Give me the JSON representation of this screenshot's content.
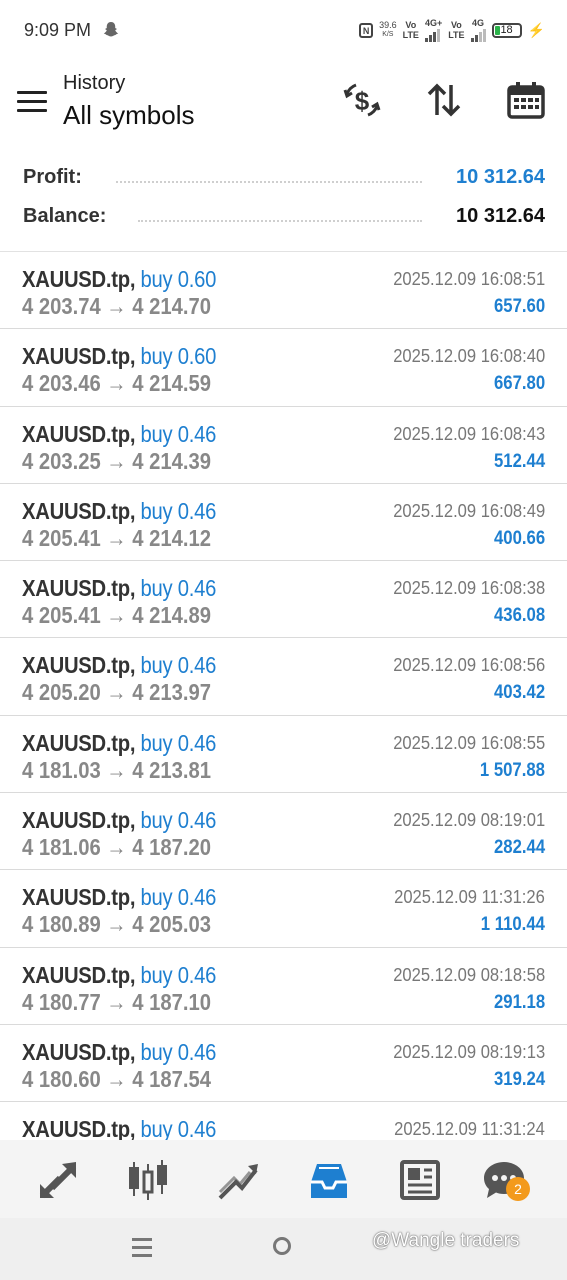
{
  "statusbar": {
    "time": "9:09 PM",
    "nfc": "N",
    "speed_value": "39.6",
    "speed_unit": "K/S",
    "sim1_top": "Vo",
    "sim1_bottom": "LTE",
    "sim1_net": "4G+",
    "sim2_top": "Vo",
    "sim2_bottom": "LTE",
    "sim2_net": "4G",
    "battery": "18"
  },
  "header": {
    "title": "History",
    "subtitle": "All symbols",
    "icons": [
      "dollar-exchange-icon",
      "sort-icon",
      "calendar-icon"
    ]
  },
  "summary": {
    "profit_label": "Profit:",
    "profit_value": "10 312.64",
    "balance_label": "Balance:",
    "balance_value": "10 312.64",
    "profit_color": "#1e7fd0",
    "balance_color": "#111111"
  },
  "trades": [
    {
      "symbol": "XAUUSD.tp,",
      "side": "buy 0.60",
      "prices": "4 203.74 → 4 214.70",
      "time": "2025.12.09 16:08:51",
      "profit": "657.60"
    },
    {
      "symbol": "XAUUSD.tp,",
      "side": "buy 0.60",
      "prices": "4 203.46 → 4 214.59",
      "time": "2025.12.09 16:08:40",
      "profit": "667.80"
    },
    {
      "symbol": "XAUUSD.tp,",
      "side": "buy 0.46",
      "prices": "4 203.25 → 4 214.39",
      "time": "2025.12.09 16:08:43",
      "profit": "512.44"
    },
    {
      "symbol": "XAUUSD.tp,",
      "side": "buy 0.46",
      "prices": "4 205.41 → 4 214.12",
      "time": "2025.12.09 16:08:49",
      "profit": "400.66"
    },
    {
      "symbol": "XAUUSD.tp,",
      "side": "buy 0.46",
      "prices": "4 205.41 → 4 214.89",
      "time": "2025.12.09 16:08:38",
      "profit": "436.08"
    },
    {
      "symbol": "XAUUSD.tp,",
      "side": "buy 0.46",
      "prices": "4 205.20 → 4 213.97",
      "time": "2025.12.09 16:08:56",
      "profit": "403.42"
    },
    {
      "symbol": "XAUUSD.tp,",
      "side": "buy 0.46",
      "prices": "4 181.03 → 4 213.81",
      "time": "2025.12.09 16:08:55",
      "profit": "1 507.88"
    },
    {
      "symbol": "XAUUSD.tp,",
      "side": "buy 0.46",
      "prices": "4 181.06 → 4 187.20",
      "time": "2025.12.09 08:19:01",
      "profit": "282.44"
    },
    {
      "symbol": "XAUUSD.tp,",
      "side": "buy 0.46",
      "prices": "4 180.89 → 4 205.03",
      "time": "2025.12.09 11:31:26",
      "profit": "1 110.44"
    },
    {
      "symbol": "XAUUSD.tp,",
      "side": "buy 0.46",
      "prices": "4 180.77 → 4 187.10",
      "time": "2025.12.09 08:18:58",
      "profit": "291.18"
    },
    {
      "symbol": "XAUUSD.tp,",
      "side": "buy 0.46",
      "prices": "4 180.60 → 4 187.54",
      "time": "2025.12.09 08:19:13",
      "profit": "319.24"
    },
    {
      "symbol": "XAUUSD.tp,",
      "side": "buy 0.46",
      "prices": "",
      "time": "2025.12.09 11:31:24",
      "profit": ""
    }
  ],
  "bottomnav": {
    "items": [
      "quotes-icon",
      "chart-icon",
      "trade-icon",
      "history-icon",
      "news-icon",
      "chat-icon"
    ],
    "active": "history-icon",
    "active_color": "#1e7fd0",
    "chat_badge": "2"
  },
  "watermark": "@Wangle traders"
}
